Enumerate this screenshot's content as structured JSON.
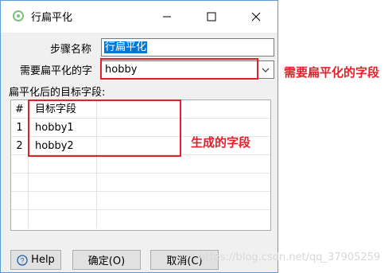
{
  "window": {
    "title": "行扁平化",
    "icon": "app-icon",
    "minimize_icon": "minimize-icon",
    "maximize_icon": "maximize-icon",
    "close_icon": "close-icon"
  },
  "form": {
    "step_name_label": "步骤名称",
    "step_name_value": "行扁平化",
    "field_label": "需要扁平化的字",
    "field_value": "hobby",
    "target_section_label": "扁平化后的目标字段:"
  },
  "table": {
    "header_num": "#",
    "header_col": "目标字段",
    "rows": [
      {
        "num": "1",
        "value": "hobby1"
      },
      {
        "num": "2",
        "value": "hobby2"
      }
    ]
  },
  "buttons": {
    "help": "Help",
    "ok": "确定(O)",
    "cancel": "取消(C)"
  },
  "annotations": {
    "field_note": "需要扁平化的字段",
    "generated_note": "生成的字段",
    "color": "#e0202a"
  },
  "watermark": "https://blog.csdn.net/qq_37905259"
}
